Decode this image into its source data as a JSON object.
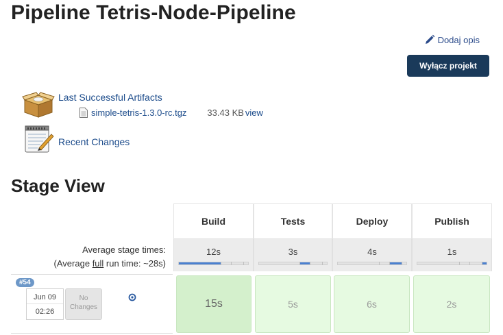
{
  "page": {
    "title": "Pipeline Tetris-Node-Pipeline"
  },
  "actions": {
    "edit_description": {
      "label": "Dodaj opis",
      "icon": "pencil-icon"
    },
    "disable_project": {
      "label": "Wyłącz projekt",
      "bg_color": "#1a3a5a"
    }
  },
  "artifacts": {
    "label": "Last Successful Artifacts",
    "icon": "package-box-icon",
    "files": [
      {
        "name": "simple-tetris-1.3.0-rc.tgz",
        "size": "33.43 KB",
        "view_label": "view",
        "icon": "file-icon"
      }
    ]
  },
  "changes": {
    "label": "Recent Changes",
    "icon": "notepad-icon"
  },
  "stage_view": {
    "title": "Stage View",
    "avg_label": "Average stage times:",
    "avg_full_prefix": "(Average ",
    "avg_full_word": "full",
    "avg_full_suffix": " run time: ~28s)",
    "stages": [
      {
        "name": "Build",
        "avg": "12s",
        "progress_start": 0.0,
        "progress_end": 0.6
      },
      {
        "name": "Tests",
        "avg": "3s",
        "progress_start": 0.6,
        "progress_end": 0.75
      },
      {
        "name": "Deploy",
        "avg": "4s",
        "progress_start": 0.75,
        "progress_end": 0.93
      },
      {
        "name": "Publish",
        "avg": "1s",
        "progress_start": 0.93,
        "progress_end": 1.0
      }
    ],
    "runs": [
      {
        "badge": "#54",
        "date": "Jun 09",
        "time": "02:26",
        "changes": "No Changes",
        "stage_times": [
          "15s",
          "5s",
          "6s",
          "2s"
        ]
      }
    ]
  },
  "colors": {
    "link": "#1a4a8a",
    "button_bg": "#1a3a5a",
    "success_dark": "#d4f0cc",
    "success_light": "#e6fae1",
    "progress": "#4a80d0",
    "badge": "#6d98c8"
  }
}
